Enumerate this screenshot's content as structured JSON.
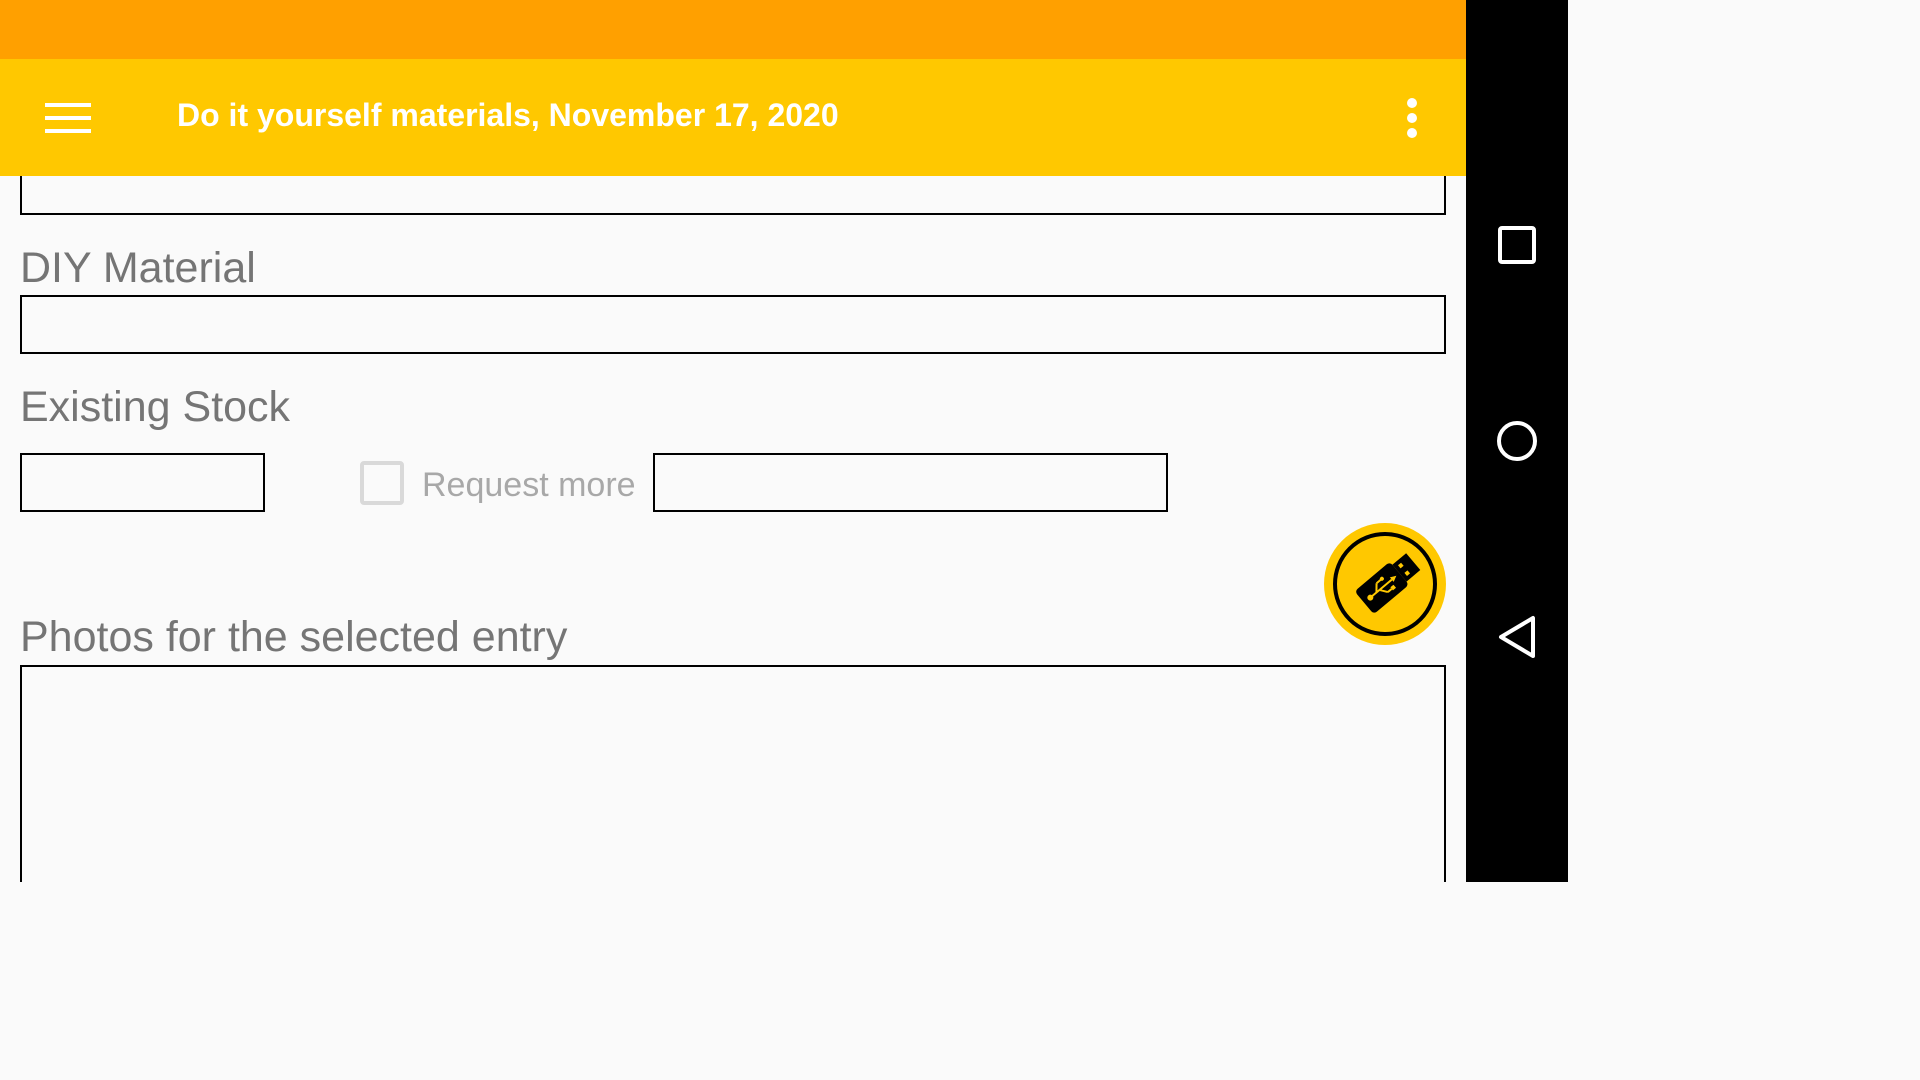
{
  "app_bar": {
    "title": "Do it yourself materials, November 17, 2020",
    "menu_icon": "hamburger-menu-icon",
    "overflow_icon": "more-vert-icon"
  },
  "form": {
    "diy_material_label": "DIY Material",
    "diy_material_value": "",
    "existing_stock_label": "Existing Stock",
    "existing_stock_value": "",
    "request_more_label": "Request more",
    "request_more_checked": false,
    "request_more_value": "",
    "photos_label": "Photos for the selected entry"
  },
  "fab": {
    "icon": "usb-drive-icon"
  },
  "navigation": {
    "recents_icon": "square-recents-icon",
    "home_icon": "circle-home-icon",
    "back_icon": "triangle-back-icon"
  },
  "colors": {
    "status_bar": "#ffa000",
    "app_bar": "#ffc800",
    "background": "#fafafa",
    "label_text": "#757575",
    "nav_bar": "#000000"
  }
}
